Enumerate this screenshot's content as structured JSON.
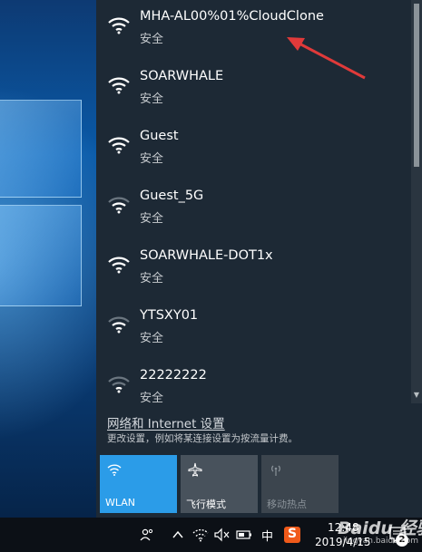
{
  "networks": [
    {
      "ssid": "MHA-AL00%01%CloudClone",
      "security": "安全"
    },
    {
      "ssid": "SOARWHALE",
      "security": "安全"
    },
    {
      "ssid": "Guest",
      "security": "安全"
    },
    {
      "ssid": "Guest_5G",
      "security": "安全"
    },
    {
      "ssid": "SOARWHALE-DOT1x",
      "security": "安全"
    },
    {
      "ssid": "YTSXY01",
      "security": "安全"
    },
    {
      "ssid": "22222222",
      "security": "安全"
    }
  ],
  "settings": {
    "link_label": "网络和 Internet 设置",
    "description": "更改设置，例如将某连接设置为按流量计费。"
  },
  "quick_actions": [
    {
      "label": "WLAN",
      "state": "on"
    },
    {
      "label": "飞行模式",
      "state": "off"
    },
    {
      "label": "移动热点",
      "state": "disabled"
    }
  ],
  "taskbar": {
    "ime_label": "中",
    "sogou_label": "S",
    "time": "12:48",
    "date": "2019/4/15",
    "notification_count": "2",
    "icons": [
      "people-icon",
      "chevron-up-icon",
      "wifi-icon",
      "volume-mute-icon",
      "battery-icon",
      "keyboard-icon",
      "sogou-icon",
      "notification-icon"
    ]
  },
  "watermark": {
    "brand": "Baidu 经验",
    "url": "jingyan.baidu.com"
  },
  "colors": {
    "accent": "#2b9ce8",
    "annotation_arrow": "#e03a3a",
    "flyout_bg": "#1d2935"
  }
}
